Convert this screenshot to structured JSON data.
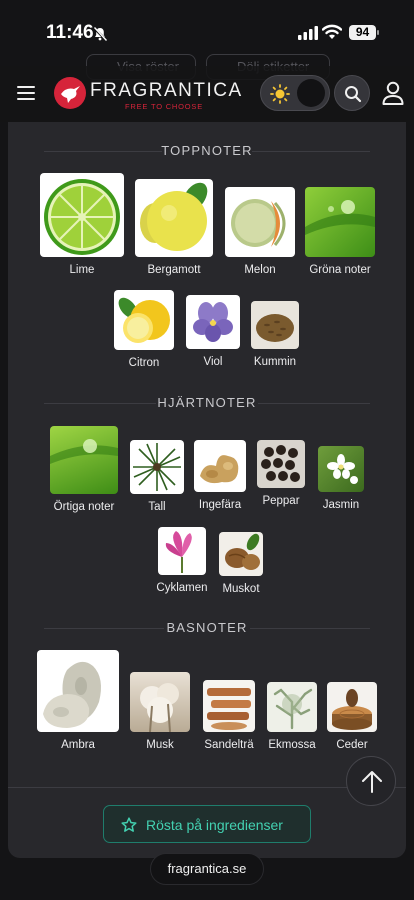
{
  "status_bar": {
    "time": "11:46",
    "battery": "94"
  },
  "ghost_buttons": {
    "vote_list": "Visa röster",
    "hide_labels": "Dölj etiketter"
  },
  "header": {
    "brand": "FRAGRANTICA",
    "tagline": "FREE TO CHOOSE"
  },
  "sections": {
    "top": {
      "title": "TOPPNOTER",
      "notes": [
        {
          "label": "Lime"
        },
        {
          "label": "Bergamott"
        },
        {
          "label": "Melon"
        },
        {
          "label": "Gröna noter"
        },
        {
          "label": "Citron"
        },
        {
          "label": "Viol"
        },
        {
          "label": "Kummin"
        }
      ]
    },
    "heart": {
      "title": "HJÄRTNOTER",
      "notes": [
        {
          "label": "Örtiga noter"
        },
        {
          "label": "Tall"
        },
        {
          "label": "Ingefära"
        },
        {
          "label": "Peppar"
        },
        {
          "label": "Jasmin"
        },
        {
          "label": "Cyklamen"
        },
        {
          "label": "Muskot"
        }
      ]
    },
    "base": {
      "title": "BASNOTER",
      "notes": [
        {
          "label": "Ambra"
        },
        {
          "label": "Musk"
        },
        {
          "label": "Sandelträ"
        },
        {
          "label": "Ekmossa"
        },
        {
          "label": "Ceder"
        }
      ]
    }
  },
  "vote_button": {
    "label": "Rösta på ingredienser"
  },
  "url_bar": {
    "domain": "fragrantica.se"
  },
  "colors": {
    "accent_teal": "#43d1b1",
    "brand_red": "#d6243a",
    "background": "#141416",
    "panel": "#28282c"
  }
}
